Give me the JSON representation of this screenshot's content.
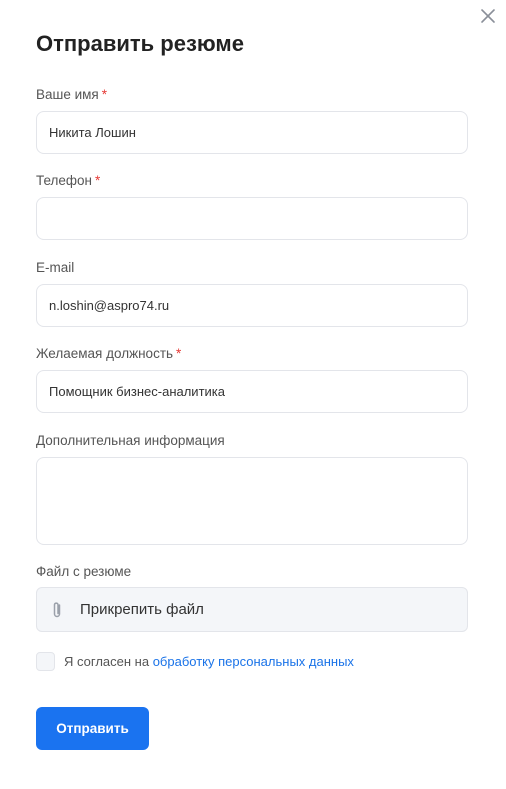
{
  "modal": {
    "title": "Отправить резюме",
    "close_icon": "close-icon"
  },
  "form": {
    "required_mark": "*",
    "name": {
      "label": "Ваше имя",
      "required": true,
      "value": "Никита Лошин"
    },
    "phone": {
      "label": "Телефон",
      "required": true,
      "value": ""
    },
    "email": {
      "label": "E-mail",
      "required": false,
      "value": "n.loshin@aspro74.ru"
    },
    "position": {
      "label": "Желаемая должность",
      "required": true,
      "value": "Помощник бизнес-аналитика"
    },
    "additional": {
      "label": "Дополнительная информация",
      "value": ""
    },
    "file": {
      "label": "Файл с резюме",
      "button_label": "Прикрепить файл",
      "icon": "paperclip-icon"
    },
    "consent": {
      "checked": false,
      "text": "Я согласен на",
      "link_text": "обработку персональных данных"
    },
    "submit_label": "Отправить"
  },
  "colors": {
    "accent": "#1a73f0",
    "link": "#1a73e8",
    "required": "#e53935",
    "field_border": "#e3e5ea",
    "file_bg": "#f4f6f9"
  }
}
